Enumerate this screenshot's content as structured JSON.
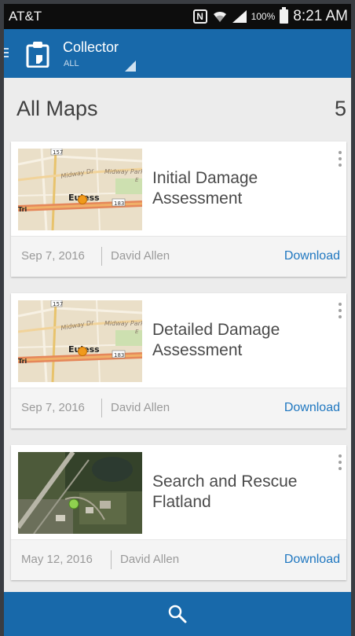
{
  "status_bar": {
    "carrier": "AT&T",
    "nfc_label": "N",
    "battery_percent": "100%",
    "time": "8:21 AM"
  },
  "app_bar": {
    "title": "Collector",
    "subtitle": "ALL",
    "color": "#1869aa"
  },
  "section": {
    "title": "All Maps",
    "count": "5"
  },
  "maps": [
    {
      "title": "Initial Damage Assessment",
      "date": "Sep 7, 2016",
      "author": "David Allen",
      "action": "Download",
      "thumbnail": "street-map",
      "thumb_labels": {
        "road_shield": "157",
        "street": "Midway Dr",
        "park": "Midway Park",
        "city": "Euless",
        "highway": "183",
        "left_edge": "Tri",
        "side": "E"
      }
    },
    {
      "title": "Detailed Damage Assessment",
      "date": "Sep 7, 2016",
      "author": "David Allen",
      "action": "Download",
      "thumbnail": "street-map",
      "thumb_labels": {
        "road_shield": "157",
        "street": "Midway Dr",
        "park": "Midway Park",
        "city": "Euless",
        "highway": "183",
        "left_edge": "Tri",
        "side": "E"
      }
    },
    {
      "title": "Search and Rescue Flatland",
      "date": "May 12, 2016",
      "author": "David Allen",
      "action": "Download",
      "thumbnail": "satellite-map"
    }
  ],
  "icons": {
    "menu": "hamburger-icon",
    "app": "clipboard-icon",
    "overflow": "overflow-menu-icon",
    "search": "search-icon"
  },
  "colors": {
    "accent": "#1869aa",
    "link": "#1f77c0",
    "marker_orange": "#f09a1c",
    "marker_green": "#8fd14f"
  }
}
